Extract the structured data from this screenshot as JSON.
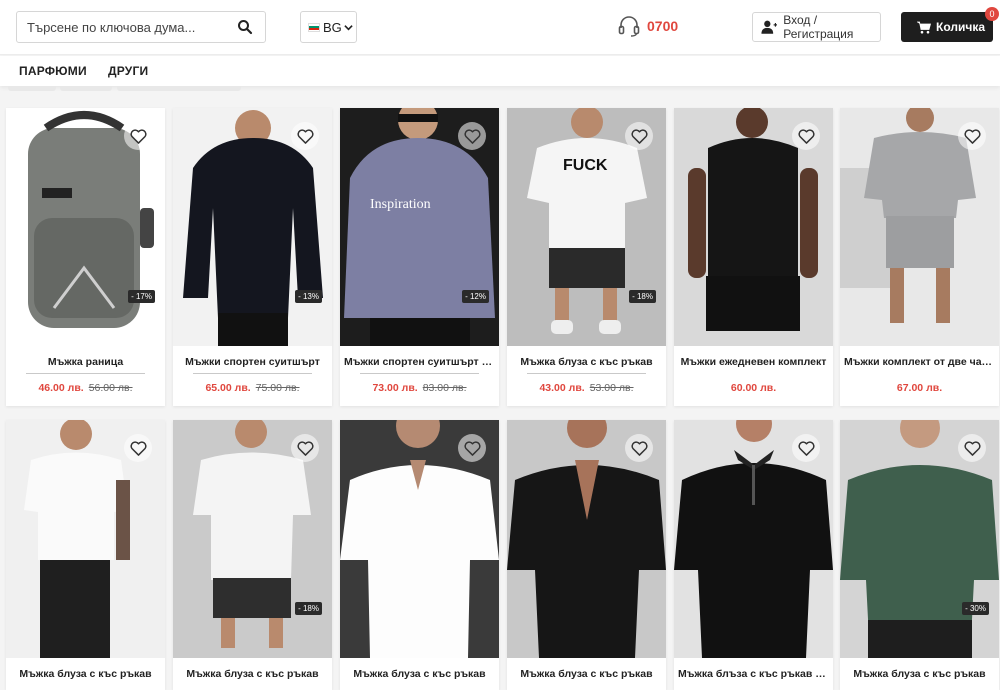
{
  "header": {
    "search_placeholder": "Търсене по ключова дума...",
    "lang_code": "BG",
    "phone": "0700",
    "login_label": "Вход / Регистрация",
    "cart_label": "Количка",
    "cart_count": "0"
  },
  "nav": {
    "items": [
      "ПАРФЮМИ",
      "ДРУГИ"
    ]
  },
  "colors": {
    "accent": "#e0473e",
    "cart_bg": "#1e1e1e"
  },
  "products": [
    {
      "title": "Мъжка раница",
      "price": "46.00 лв.",
      "old_price": "56.00 лв.",
      "discount": "- 17%"
    },
    {
      "title": "Мъжки спортен суитшърт",
      "price": "65.00 лв.",
      "old_price": "75.00 лв.",
      "discount": "- 13%"
    },
    {
      "title": "Мъжки спортен суитшърт с ...",
      "price": "73.00 лв.",
      "old_price": "83.00 лв.",
      "discount": "- 12%"
    },
    {
      "title": "Мъжка блуза с къс ръкав",
      "price": "43.00 лв.",
      "old_price": "53.00 лв.",
      "discount": "- 18%"
    },
    {
      "title": "Мъжки ежедневен комплект",
      "price": "60.00 лв.",
      "old_price": "",
      "discount": ""
    },
    {
      "title": "Мъжки комплект от две части",
      "price": "67.00 лв.",
      "old_price": "",
      "discount": ""
    },
    {
      "title": "Мъжка блуза с къс ръкав",
      "price": "",
      "old_price": "",
      "discount": ""
    },
    {
      "title": "Мъжка блуза с къс ръкав",
      "price": "",
      "old_price": "",
      "discount": "- 18%"
    },
    {
      "title": "Мъжка блуза с къс ръкав",
      "price": "",
      "old_price": "",
      "discount": ""
    },
    {
      "title": "Мъжка блуза с къс ръкав",
      "price": "",
      "old_price": "",
      "discount": ""
    },
    {
      "title": "Мъжка блъза с къс ръкав и ...",
      "price": "",
      "old_price": "",
      "discount": ""
    },
    {
      "title": "Мъжка блуза с къс ръкав",
      "price": "",
      "old_price": "",
      "discount": "- 30%"
    }
  ]
}
